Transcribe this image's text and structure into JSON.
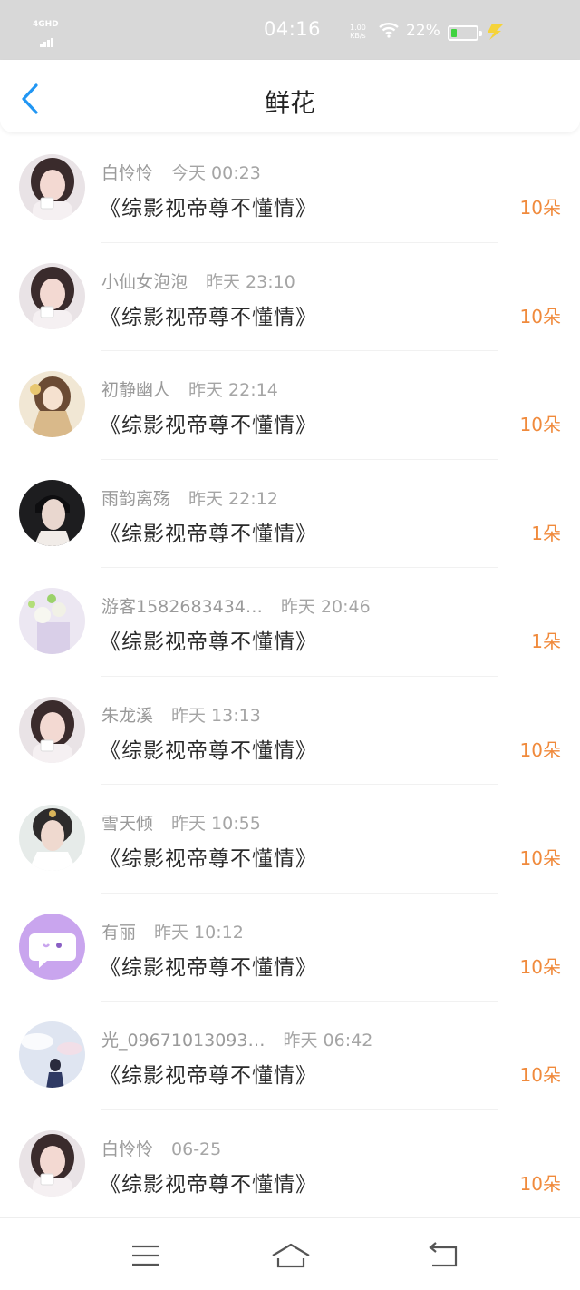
{
  "status_bar": {
    "network": "4GHD",
    "time": "04:16",
    "speed_value": "1.00",
    "speed_unit": "KB/s",
    "battery_percent": "22%",
    "battery_level": 0.22
  },
  "header": {
    "title": "鲜花"
  },
  "items": [
    {
      "user": "白怜怜",
      "time": "今天 00:23",
      "book": "《综影视帝尊不懂情》",
      "count": "10朵",
      "avatar_icon": "girl-avatar-icon"
    },
    {
      "user": "小仙女泡泡",
      "time": "昨天 23:10",
      "book": "《综影视帝尊不懂情》",
      "count": "10朵",
      "avatar_icon": "girl-avatar-icon"
    },
    {
      "user": "初静幽人",
      "time": "昨天 22:14",
      "book": "《综影视帝尊不懂情》",
      "count": "10朵",
      "avatar_icon": "anime-avatar-icon"
    },
    {
      "user": "雨韵离殇",
      "time": "昨天 22:12",
      "book": "《综影视帝尊不懂情》",
      "count": "1朵",
      "avatar_icon": "man-avatar-icon"
    },
    {
      "user": "游客1582683434…",
      "time": "昨天 20:46",
      "book": "《综影视帝尊不懂情》",
      "count": "1朵",
      "avatar_icon": "flower-avatar-icon"
    },
    {
      "user": "朱龙溪",
      "time": "昨天 13:13",
      "book": "《综影视帝尊不懂情》",
      "count": "10朵",
      "avatar_icon": "girl-avatar-icon"
    },
    {
      "user": "雪天倾",
      "time": "昨天 10:55",
      "book": "《综影视帝尊不懂情》",
      "count": "10朵",
      "avatar_icon": "costume-avatar-icon"
    },
    {
      "user": "有丽",
      "time": "昨天 10:12",
      "book": "《综影视帝尊不懂情》",
      "count": "10朵",
      "avatar_icon": "chat-bubble-avatar-icon"
    },
    {
      "user": "光_09671013093…",
      "time": "昨天 06:42",
      "book": "《综影视帝尊不懂情》",
      "count": "10朵",
      "avatar_icon": "sky-avatar-icon"
    },
    {
      "user": "白怜怜",
      "time": "06-25",
      "book": "《综影视帝尊不懂情》",
      "count": "10朵",
      "avatar_icon": "girl-avatar-icon"
    }
  ],
  "nav_bar": {
    "buttons": [
      "menu-icon",
      "home-icon",
      "back-icon"
    ]
  },
  "colors": {
    "accent": "#2196f3",
    "count": "#f08a3c",
    "status_bar_bg": "#d8d8d8"
  }
}
